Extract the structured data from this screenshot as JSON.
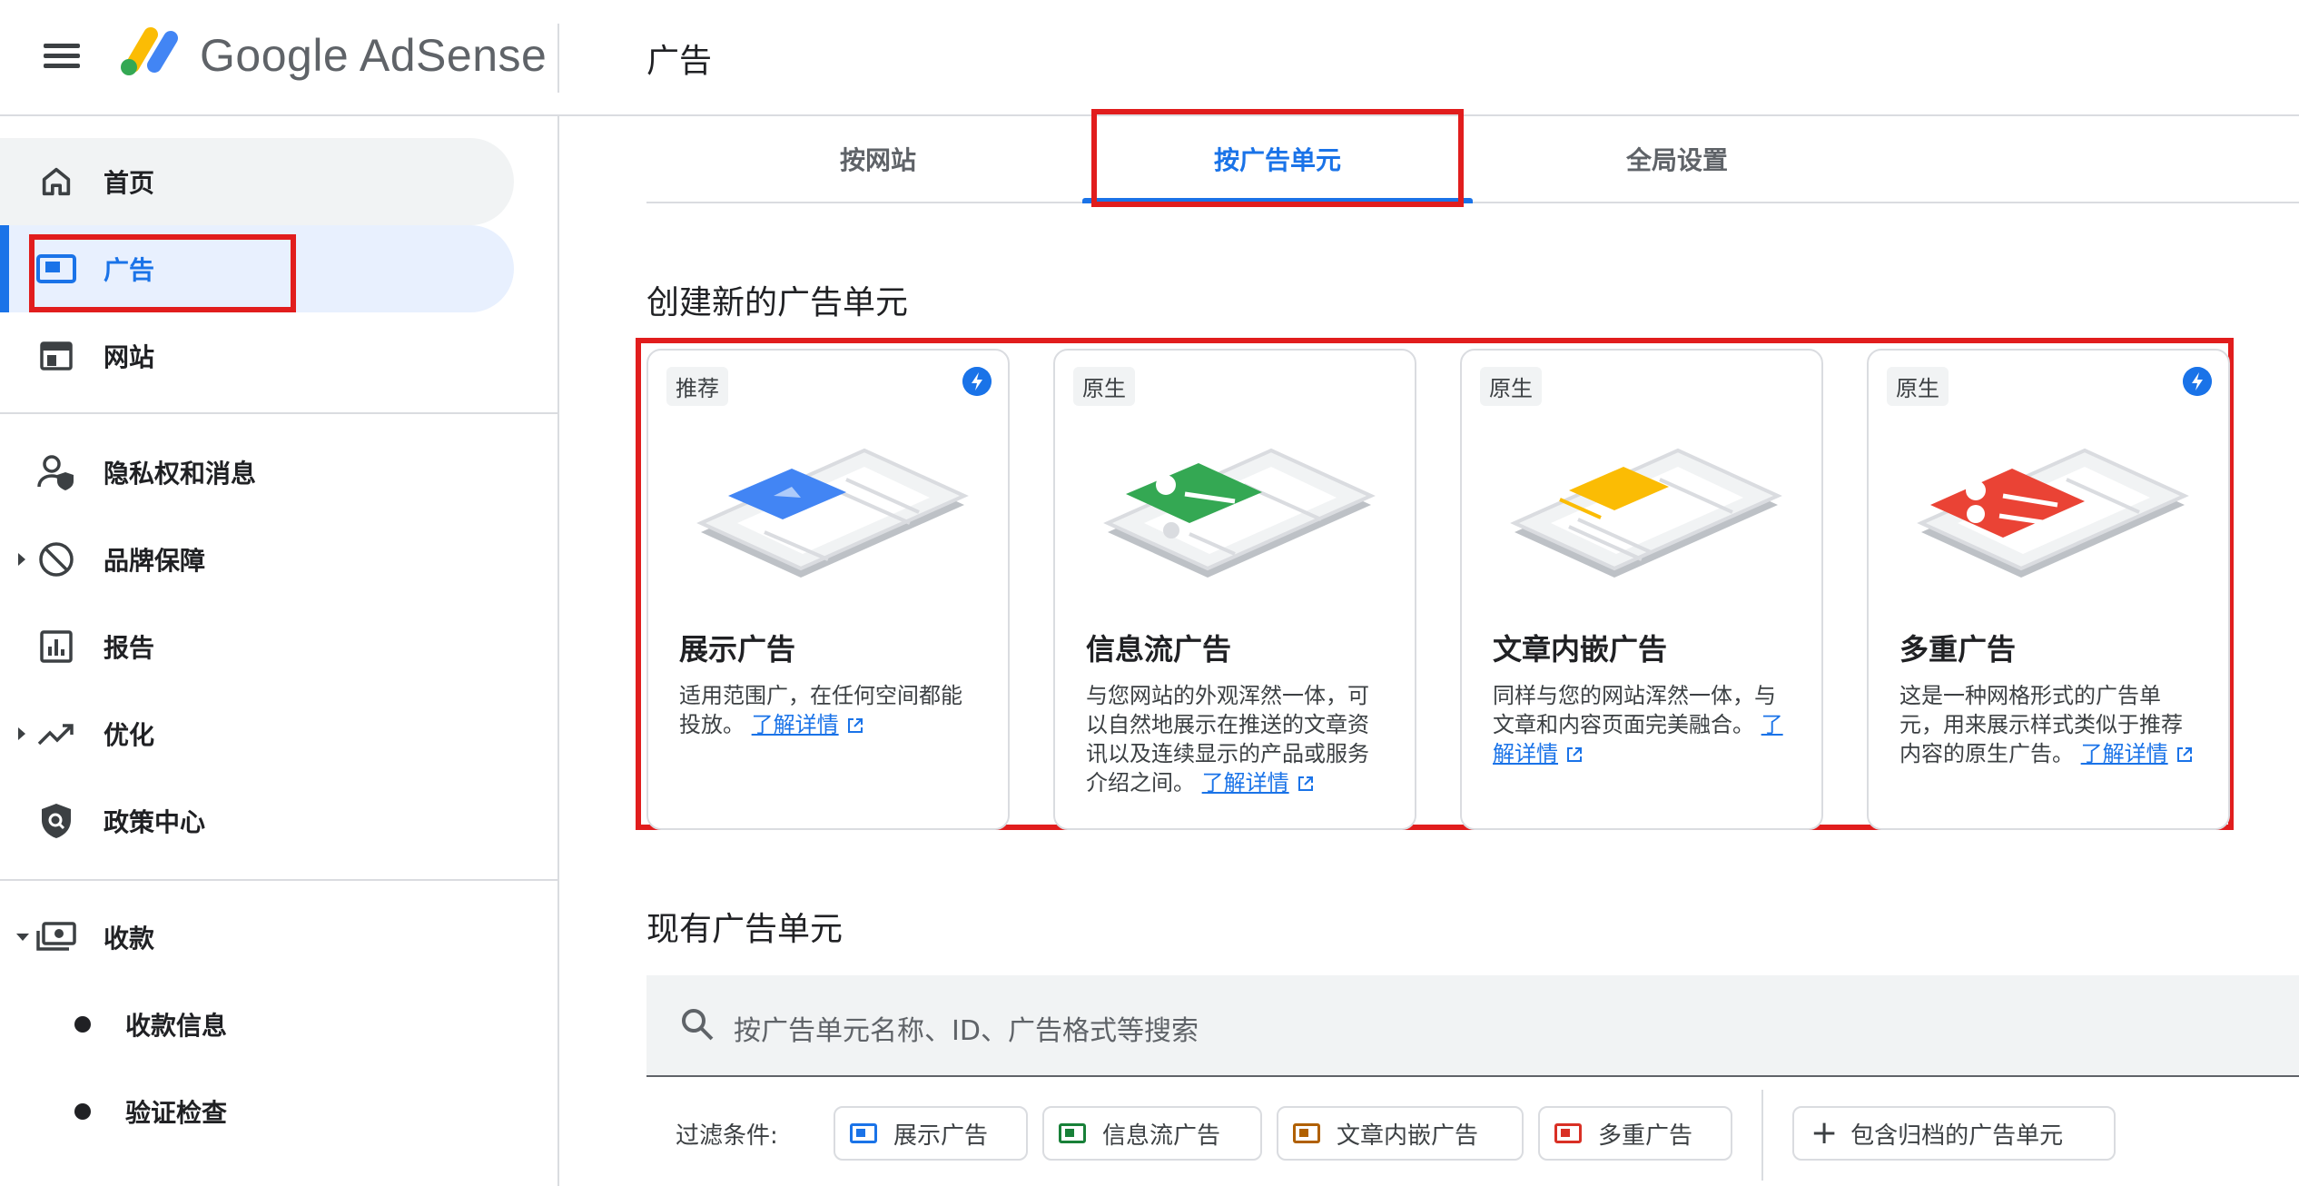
{
  "app": {
    "brand_google": "Google",
    "brand_product": "AdSense",
    "page_title": "广告"
  },
  "sidebar": {
    "items": [
      {
        "label": "首页",
        "icon": "home-icon"
      },
      {
        "label": "广告",
        "icon": "ads-icon",
        "active": true
      },
      {
        "label": "网站",
        "icon": "sites-icon"
      },
      {
        "label": "隐私权和消息",
        "icon": "privacy-icon"
      },
      {
        "label": "品牌保障",
        "icon": "block-icon"
      },
      {
        "label": "报告",
        "icon": "reports-icon"
      },
      {
        "label": "优化",
        "icon": "trending-icon"
      },
      {
        "label": "政策中心",
        "icon": "policy-shield-icon"
      },
      {
        "label": "收款",
        "icon": "payments-icon"
      }
    ],
    "sub_items": [
      {
        "label": "收款信息"
      },
      {
        "label": "验证检查"
      }
    ]
  },
  "tabs": [
    {
      "label": "按网站"
    },
    {
      "label": "按广告单元",
      "active": true
    },
    {
      "label": "全局设置"
    }
  ],
  "create_section": {
    "title": "创建新的广告单元",
    "learn_more": "了解详情",
    "cards": [
      {
        "badge": "推荐",
        "title": "展示广告",
        "desc": "适用范围广，在任何空间都能投放。",
        "accent": "#4285f4",
        "has_bolt": true
      },
      {
        "badge": "原生",
        "title": "信息流广告",
        "desc": "与您网站的外观浑然一体，可以自然地展示在推送的文章资讯以及连续显示的产品或服务介绍之间。",
        "accent": "#34a853",
        "has_bolt": false
      },
      {
        "badge": "原生",
        "title": "文章内嵌广告",
        "desc": "同样与您的网站浑然一体，与文章和内容页面完美融合。",
        "accent": "#fbbc04",
        "has_bolt": false
      },
      {
        "badge": "原生",
        "title": "多重广告",
        "desc": "这是一种网格形式的广告单元，用来展示样式类似于推荐内容的原生广告。",
        "accent": "#ea4335",
        "has_bolt": true
      }
    ]
  },
  "existing_section": {
    "title": "现有广告单元",
    "search_placeholder": "按广告单元名称、ID、广告格式等搜索"
  },
  "filters": {
    "label": "过滤条件:",
    "chips": [
      {
        "label": "展示广告",
        "color": "#1a73e8"
      },
      {
        "label": "信息流广告",
        "color": "#188038"
      },
      {
        "label": "文章内嵌广告",
        "color": "#b06000"
      },
      {
        "label": "多重广告",
        "color": "#d93025"
      }
    ],
    "include_archived": "包含归档的广告单元"
  },
  "colors": {
    "accent": "#1a73e8",
    "annotation_red": "#e11d1d"
  }
}
